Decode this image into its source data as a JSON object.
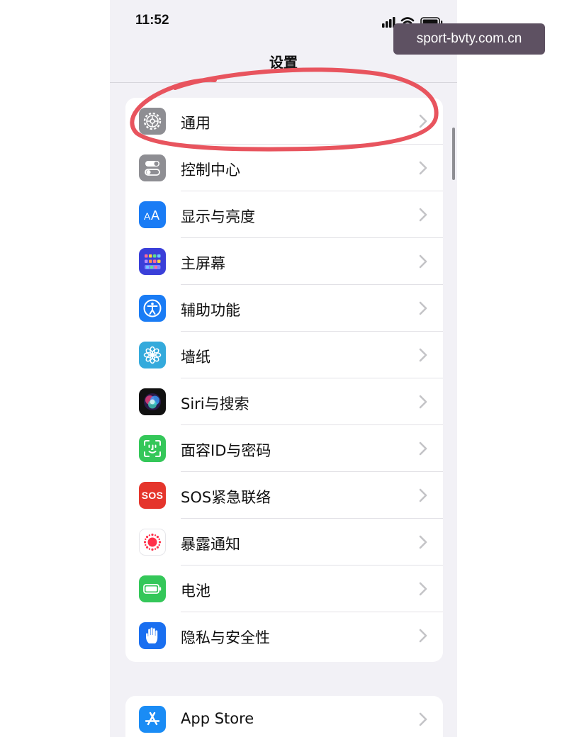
{
  "status_bar": {
    "time": "11:52"
  },
  "nav": {
    "title": "设置"
  },
  "settings_items": [
    {
      "label": "通用",
      "icon": "gear-icon",
      "color": "#8e8e93"
    },
    {
      "label": "控制中心",
      "icon": "control-center-icon",
      "color": "#8e8e93"
    },
    {
      "label": "显示与亮度",
      "icon": "display-brightness-icon",
      "color": "#1a7cf5"
    },
    {
      "label": "主屏幕",
      "icon": "home-screen-icon",
      "color": "#3a3fd9"
    },
    {
      "label": "辅助功能",
      "icon": "accessibility-icon",
      "color": "#1a7cf5"
    },
    {
      "label": "墙纸",
      "icon": "wallpaper-icon",
      "color": "#34aadc"
    },
    {
      "label": "Siri与搜索",
      "icon": "siri-icon",
      "color": "#111111"
    },
    {
      "label": "面容ID与密码",
      "icon": "face-id-icon",
      "color": "#34c759"
    },
    {
      "label": "SOS紧急联络",
      "icon": "sos-icon",
      "color": "#e5352c",
      "icon_text": "SOS"
    },
    {
      "label": "暴露通知",
      "icon": "exposure-notification-icon",
      "color": "#ffffff"
    },
    {
      "label": "电池",
      "icon": "battery-icon",
      "color": "#34c759"
    },
    {
      "label": "隐私与安全性",
      "icon": "privacy-hand-icon",
      "color": "#1a6ff0"
    }
  ],
  "store_items": [
    {
      "label": "App Store",
      "icon": "app-store-icon",
      "color": "#1a8cf5"
    }
  ],
  "watermark": {
    "text": "sport-bvty.com.cn"
  },
  "annotation": {
    "color": "#e8545e",
    "circled_item": "通用"
  }
}
